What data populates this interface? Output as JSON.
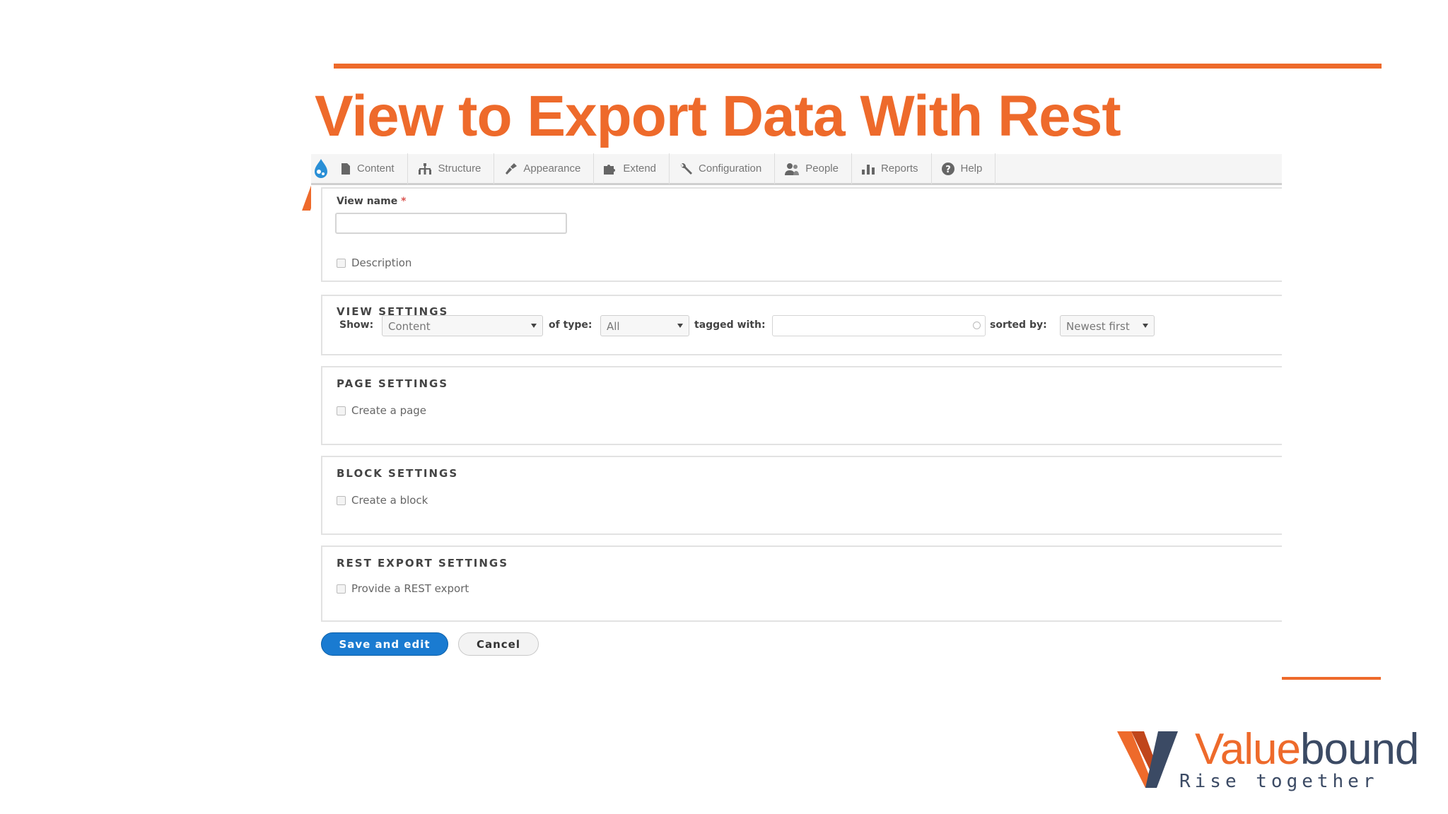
{
  "slide": {
    "title": "View to Export Data With Rest",
    "title_overflow": "A"
  },
  "toolbar": {
    "items": [
      {
        "label": "Content",
        "icon": "page-icon"
      },
      {
        "label": "Structure",
        "icon": "sitemap-icon"
      },
      {
        "label": "Appearance",
        "icon": "brush-icon"
      },
      {
        "label": "Extend",
        "icon": "puzzle-icon"
      },
      {
        "label": "Configuration",
        "icon": "wrench-icon"
      },
      {
        "label": "People",
        "icon": "people-icon"
      },
      {
        "label": "Reports",
        "icon": "bar-chart-icon"
      },
      {
        "label": "Help",
        "icon": "help-icon"
      }
    ]
  },
  "form": {
    "view_name_label": "View name",
    "required_mark": "*",
    "view_name_value": "",
    "description_label": "Description",
    "view_settings": {
      "title": "VIEW SETTINGS",
      "show_label": "Show:",
      "show_value": "Content",
      "of_type_label": "of type:",
      "of_type_value": "All",
      "tagged_with_label": "tagged with:",
      "tagged_with_value": "",
      "sorted_by_label": "sorted by:",
      "sorted_by_value": "Newest first"
    },
    "page_settings": {
      "title": "PAGE SETTINGS",
      "checkbox_label": "Create a page"
    },
    "block_settings": {
      "title": "BLOCK SETTINGS",
      "checkbox_label": "Create a block"
    },
    "rest_export_settings": {
      "title": "REST EXPORT SETTINGS",
      "checkbox_label": "Provide a REST export"
    },
    "save_label": "Save and edit",
    "cancel_label": "Cancel"
  },
  "logo": {
    "brand_prefix": "Value",
    "brand_suffix": "bound",
    "tagline": "Rise together",
    "colors": {
      "orange": "#ee6a2b",
      "navy": "#3b4a64"
    }
  },
  "colors": {
    "accent": "#ee6a2b",
    "primary_button": "#1a7bd1"
  }
}
